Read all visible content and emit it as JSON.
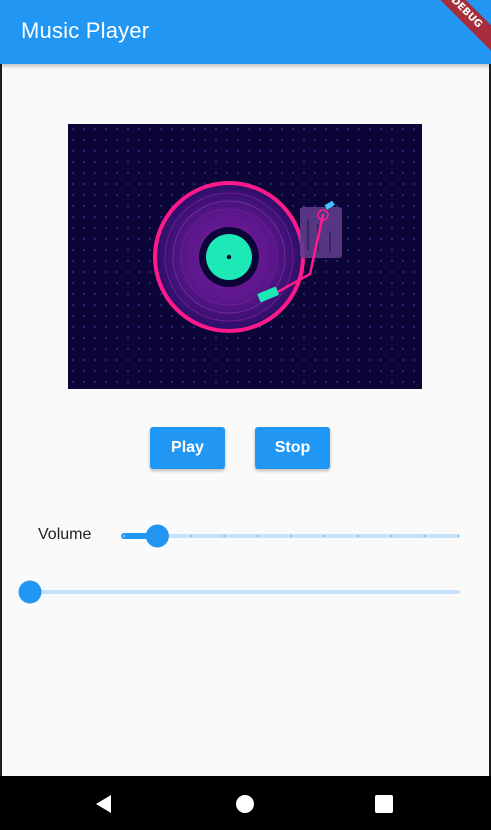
{
  "app_bar": {
    "title": "Music Player",
    "debug_banner": "DEBUG",
    "color": "#2196F3"
  },
  "album_art": {
    "description_icon": "vinyl-turntable-illustration"
  },
  "controls": {
    "play_label": "Play",
    "stop_label": "Stop"
  },
  "volume": {
    "label": "Volume",
    "value_fraction": 0.1,
    "divisions": 10
  },
  "progress": {
    "value_fraction": 0.0
  },
  "nav_bar": {
    "back_icon": "back-triangle-icon",
    "home_icon": "home-circle-icon",
    "recents_icon": "recents-square-icon"
  },
  "colors": {
    "accent": "#2196F3",
    "track_inactive": "#c6e2fb",
    "background": "#fafafa",
    "nav_bar": "#000000"
  }
}
